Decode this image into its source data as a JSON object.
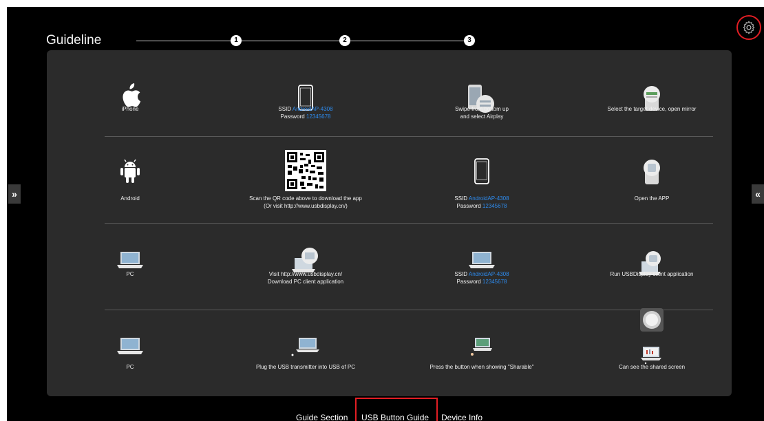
{
  "header": {
    "title": "Guideline",
    "steps": [
      "1",
      "2",
      "3"
    ]
  },
  "rows": [
    {
      "cells": [
        {
          "icon": "apple-icon",
          "lines": [
            {
              "text": "iPhone"
            }
          ]
        },
        {
          "icon": "phone-icon",
          "lines": [
            {
              "label": "SSID",
              "value": "AndroidAP-4308"
            },
            {
              "label": "Password",
              "value": "12345678"
            }
          ]
        },
        {
          "icon": "phone-swipe-icon",
          "lines": [
            {
              "text": "Swipe from bottom up"
            },
            {
              "text": "and select Airplay"
            }
          ]
        },
        {
          "icon": "mirror-device-icon",
          "lines": [
            {
              "text": "Select the target device, open mirror"
            }
          ]
        }
      ]
    },
    {
      "cells": [
        {
          "icon": "android-icon",
          "lines": [
            {
              "text": "Android"
            }
          ]
        },
        {
          "icon": "qr-code-icon",
          "lines": [
            {
              "text": "Scan the QR code above to download the app"
            },
            {
              "text": "(Or visit http://www.usbdisplay.cn/)"
            }
          ]
        },
        {
          "icon": "phone-icon",
          "lines": [
            {
              "label": "SSID",
              "value": "AndroidAP-4308"
            },
            {
              "label": "Password",
              "value": "12345678"
            }
          ]
        },
        {
          "icon": "open-app-icon",
          "lines": [
            {
              "text": "Open the APP"
            }
          ]
        }
      ]
    },
    {
      "cells": [
        {
          "icon": "laptop-icon",
          "lines": [
            {
              "text": "PC"
            }
          ]
        },
        {
          "icon": "laptop-download-icon",
          "lines": [
            {
              "text": "Visit http://www.usbdisplay.cn/"
            },
            {
              "text": "Download PC client application"
            }
          ]
        },
        {
          "icon": "laptop-icon",
          "lines": [
            {
              "label": "SSID",
              "value": "AndroidAP-4308"
            },
            {
              "label": "Password",
              "value": "12345678"
            }
          ]
        },
        {
          "icon": "laptop-client-icon",
          "lines": [
            {
              "text": "Run USBDisplay client application"
            }
          ]
        }
      ]
    },
    {
      "cells": [
        {
          "icon": "laptop-icon",
          "lines": [
            {
              "text": "PC"
            }
          ]
        },
        {
          "icon": "laptop-usb-icon",
          "lines": [
            {
              "text": "Plug the USB transmitter into USB of PC"
            }
          ]
        },
        {
          "icon": "laptop-button-icon",
          "lines": [
            {
              "text": "Press the button when showing \"Sharable\""
            }
          ]
        },
        {
          "icon": "laptop-share-icon",
          "lines": [
            {
              "text": "Can see the shared screen"
            }
          ]
        }
      ]
    }
  ],
  "side": {
    "left": "»",
    "right": "«"
  },
  "tabs": [
    {
      "label": "Guide Section"
    },
    {
      "label": "USB Button Guide"
    },
    {
      "label": "Device Info"
    }
  ],
  "colors": {
    "accent_blue": "#2d8cf0",
    "highlight_red": "#e31e24",
    "panel": "#2b2b2b"
  }
}
